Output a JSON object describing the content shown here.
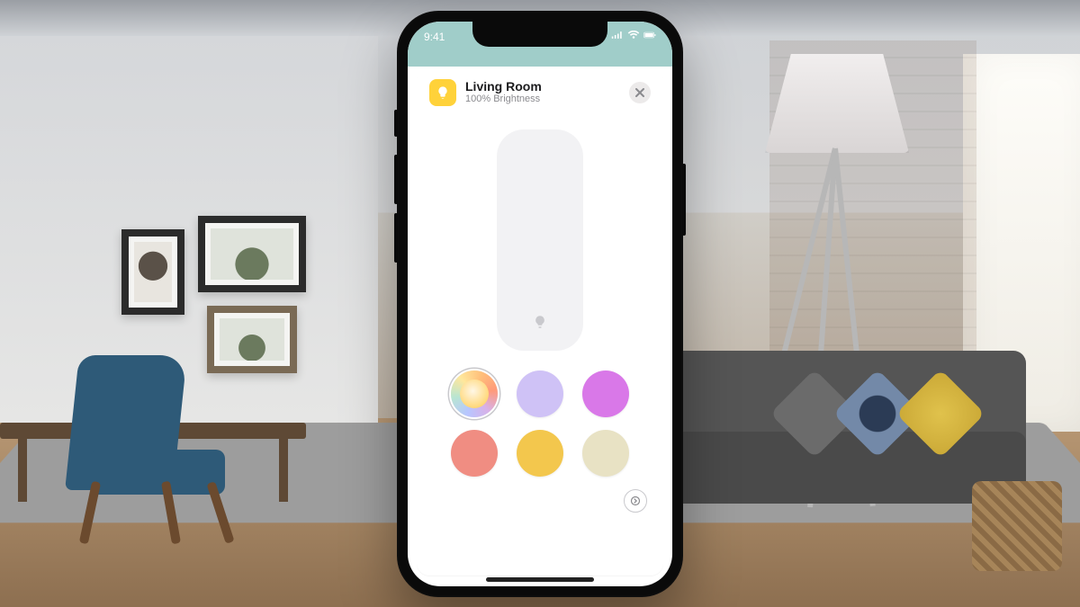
{
  "statusbar": {
    "time": "9:41"
  },
  "header": {
    "room_name": "Living Room",
    "subtitle": "100% Brightness"
  },
  "brightness": {
    "percent": 100
  },
  "swatches": [
    {
      "id": "color-wheel",
      "type": "gradient",
      "selected": true,
      "hex": null
    },
    {
      "id": "lavender",
      "type": "solid",
      "selected": false,
      "hex": "#cfc2f6"
    },
    {
      "id": "magenta",
      "type": "solid",
      "selected": false,
      "hex": "#d978e8"
    },
    {
      "id": "coral",
      "type": "solid",
      "selected": false,
      "hex": "#f08d82"
    },
    {
      "id": "gold",
      "type": "solid",
      "selected": false,
      "hex": "#f3c74d"
    },
    {
      "id": "warm-white",
      "type": "solid",
      "selected": false,
      "hex": "#e8e2c4"
    }
  ],
  "colors": {
    "statusbar_bg": "#a0cdc9",
    "bulb_badge": "#ffd23a",
    "slider_track": "#f2f2f4"
  }
}
